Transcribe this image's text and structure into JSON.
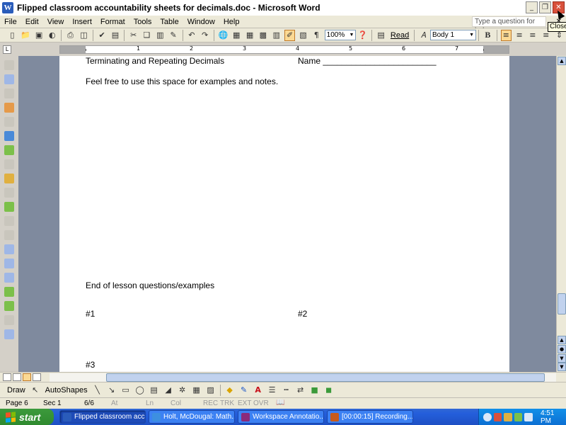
{
  "window": {
    "title": "Flipped classroom accountability sheets for decimals.doc - Microsoft Word",
    "tooltip": "Close"
  },
  "menu": {
    "items": [
      "File",
      "Edit",
      "View",
      "Insert",
      "Format",
      "Tools",
      "Table",
      "Window",
      "Help"
    ],
    "help_placeholder": "Type a question for help"
  },
  "toolbar": {
    "zoom": "100%",
    "read_label": "Read",
    "style": "Body 1",
    "bold_label": "B"
  },
  "ruler": {
    "numbers": [
      "1",
      "2",
      "3",
      "4",
      "5",
      "6",
      "7"
    ]
  },
  "document": {
    "heading_left": "Terminating and Repeating Decimals",
    "heading_right": "Name ________________________",
    "notes_line": "Feel free to use this space for examples and notes.",
    "end_section": "End of lesson questions/examples",
    "q1": "#1",
    "q2": "#2",
    "q3": "#3"
  },
  "drawbar": {
    "draw_label": "Draw",
    "autoshapes_label": "AutoShapes"
  },
  "status": {
    "page": "Page 6",
    "sec": "Sec 1",
    "pages": "6/6",
    "at": "At",
    "ln": "Ln",
    "col": "Col",
    "rec": "REC",
    "trk": "TRK",
    "ext": "EXT",
    "ovr": "OVR"
  },
  "taskbar": {
    "start_label": "start",
    "tasks": [
      {
        "label": "Flipped classroom acc...",
        "color": "#2a5cba"
      },
      {
        "label": "Holt, McDougal: Math...",
        "color": "#3d8fe0"
      },
      {
        "label": "Workspace Annotatio...",
        "color": "#8a2a7a"
      },
      {
        "label": "[00:00:15] Recording...",
        "color": "#c85a1a"
      }
    ],
    "clock": "4:51 PM"
  }
}
